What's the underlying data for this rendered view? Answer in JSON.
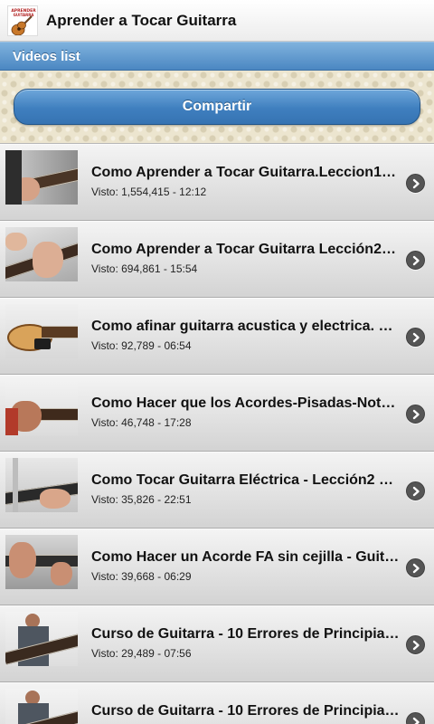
{
  "app": {
    "title": "Aprender a Tocar Guitarra",
    "logo_text": "APRENDER A TOCAR GUITARRA"
  },
  "section": {
    "title": "Videos list"
  },
  "share_button": {
    "label": "Compartir"
  },
  "colors": {
    "header_blue": "#4b87c2",
    "button_blue": "#3f7fbf",
    "list_bg": "#e3e3e3"
  },
  "videos": [
    {
      "title": "Como Aprender a Tocar Guitarra.Leccion1…",
      "meta": "Visto: 1,554,415 - 12:12",
      "icon": "chevron-right-icon"
    },
    {
      "title": "Como Aprender a Tocar Guitarra Lección2…",
      "meta": "Visto: 694,861 - 15:54",
      "icon": "chevron-right-icon"
    },
    {
      "title": "Como afinar guitarra acustica y electrica. P…",
      "meta": "Visto: 92,789 - 06:54",
      "icon": "chevron-right-icon"
    },
    {
      "title": "Como Hacer que los Acordes-Pisadas-Not…",
      "meta": "Visto: 46,748 - 17:28",
      "icon": "chevron-right-icon"
    },
    {
      "title": "Como Tocar Guitarra Eléctrica - Lección2 …",
      "meta": "Visto: 35,826 - 22:51",
      "icon": "chevron-right-icon"
    },
    {
      "title": "Como Hacer un Acorde FA sin cejilla - Guit…",
      "meta": "Visto: 39,668 - 06:29",
      "icon": "chevron-right-icon"
    },
    {
      "title": "Curso de Guitarra - 10 Errores de Principia…",
      "meta": "Visto: 29,489 - 07:56",
      "icon": "chevron-right-icon"
    },
    {
      "title": "Curso de Guitarra - 10 Errores de Principia…",
      "meta": "",
      "icon": "chevron-right-icon"
    }
  ]
}
